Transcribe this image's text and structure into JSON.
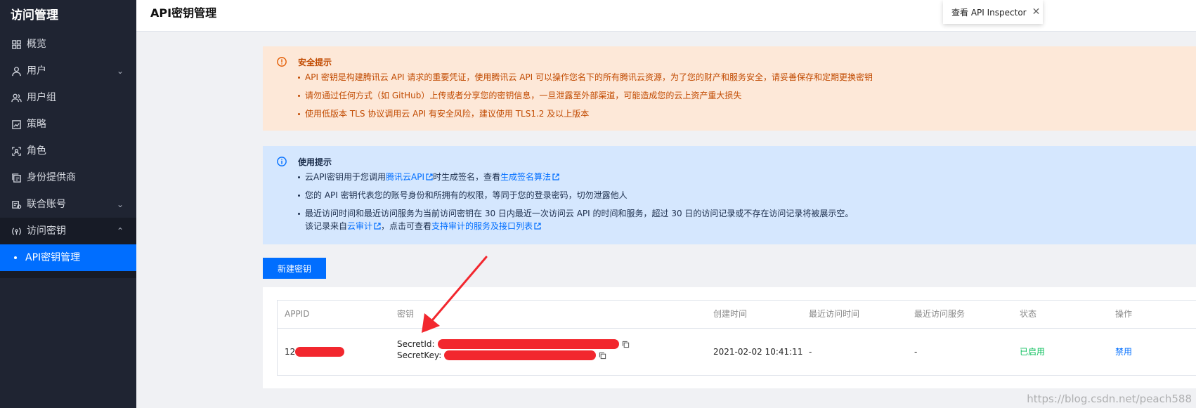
{
  "sidebar": {
    "title": "访问管理",
    "items": [
      {
        "label": "概览",
        "icon": "grid-icon",
        "has_chevron": false
      },
      {
        "label": "用户",
        "icon": "user-icon",
        "has_chevron": true,
        "chevron": "⌄"
      },
      {
        "label": "用户组",
        "icon": "user-group-icon",
        "has_chevron": false
      },
      {
        "label": "策略",
        "icon": "policy-icon",
        "has_chevron": false
      },
      {
        "label": "角色",
        "icon": "role-icon",
        "has_chevron": false
      },
      {
        "label": "身份提供商",
        "icon": "identity-provider-icon",
        "has_chevron": false
      },
      {
        "label": "联合账号",
        "icon": "federated-account-icon",
        "has_chevron": true,
        "chevron": "⌄"
      },
      {
        "label": "访问密钥",
        "icon": "access-key-icon",
        "has_chevron": true,
        "chevron": "⌃"
      }
    ],
    "sub_item": "API密钥管理"
  },
  "header": {
    "title": "API密钥管理",
    "inspector_label": "查看 API Inspector",
    "inspector_close": "✕"
  },
  "security_notice": {
    "title": "安全提示",
    "items": [
      "API 密钥是构建腾讯云 API 请求的重要凭证，使用腾讯云 API 可以操作您名下的所有腾讯云资源，为了您的财产和服务安全，请妥善保存和定期更换密钥",
      "请勿通过任何方式（如 GitHub）上传或者分享您的密钥信息，一旦泄露至外部渠道，可能造成您的云上资产重大损失",
      "使用低版本 TLS 协议调用云 API 有安全风险，建议使用 TLS1.2 及以上版本"
    ]
  },
  "usage_notice": {
    "title": "使用提示",
    "item1_pre": "云API密钥用于您调用",
    "item1_link1": "腾讯云API",
    "item1_mid": "时生成签名，查看",
    "item1_link2": "生成签名算法",
    "item2": "您的 API 密钥代表您的账号身份和所拥有的权限，等同于您的登录密码，切勿泄露他人",
    "item3_line1": "最近访问时间和最近访问服务为当前访问密钥在 30 日内最近一次访问云 API 的时间和服务，超过 30 日的访问记录或不存在访问记录将被展示空。",
    "item3_pre": "该记录来自",
    "item3_link1": "云审计",
    "item3_mid": "，点击可查看",
    "item3_link2": "支持审计的服务及接口列表"
  },
  "create_button": "新建密钥",
  "table": {
    "headers": {
      "appid": "APPID",
      "key": "密钥",
      "created": "创建时间",
      "last_access_time": "最近访问时间",
      "last_access_service": "最近访问服务",
      "status": "状态",
      "actions": "操作"
    },
    "row": {
      "appid_prefix": "12",
      "secret_id_label": "SecretId:",
      "secret_key_label": "SecretKey:",
      "created": "2021-02-02 10:41:11",
      "last_access_time": "-",
      "last_access_service": "-",
      "status": "已启用",
      "action": "禁用"
    }
  },
  "watermark": "https://blog.csdn.net/peach588",
  "colors": {
    "accent": "#006eff",
    "sidebar_bg": "#1f2432",
    "warning_bg": "#fde8d8",
    "warning_text": "#c14a00",
    "info_bg": "#d5e7fe",
    "status_enabled": "#0abf5b",
    "redaction": "#f2272e"
  }
}
